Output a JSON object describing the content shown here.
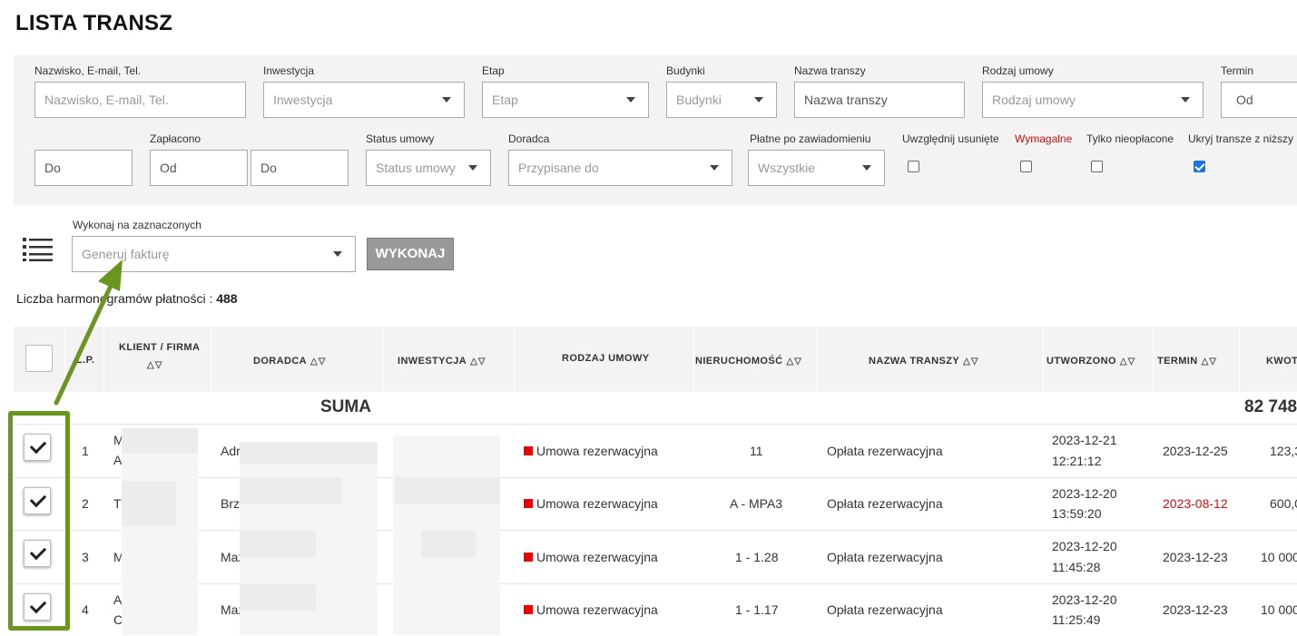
{
  "page": {
    "title": "LISTA TRANSZ"
  },
  "filters": {
    "row1": [
      {
        "label": "Nazwisko, E-mail, Tel.",
        "placeholder": "Nazwisko, E-mail, Tel."
      },
      {
        "label": "Inwestycja",
        "placeholder": "Inwestycja"
      },
      {
        "label": "Etap",
        "placeholder": "Etap"
      },
      {
        "label": "Budynki",
        "placeholder": "Budynki"
      },
      {
        "label": "Nazwa transzy",
        "placeholder": "Nazwa transzy"
      },
      {
        "label": "Rodzaj umowy",
        "placeholder": "Rodzaj umowy"
      },
      {
        "label": "Termin",
        "placeholder": "Od"
      }
    ],
    "termin_do": "Do",
    "zaplacono": {
      "label": "Zapłacono",
      "from": "Od",
      "to": "Do"
    },
    "status": {
      "label": "Status umowy",
      "placeholder": "Status umowy"
    },
    "doradca": {
      "label": "Doradca",
      "placeholder": "Przypisane do"
    },
    "platne": {
      "label": "Płatne po zawiadomieniu",
      "value": "Wszystkie"
    },
    "checkboxes": [
      {
        "label": "Uwzględnij usunięte",
        "checked": false
      },
      {
        "label": "Wymagalne",
        "checked": false,
        "color": "#d01010"
      },
      {
        "label": "Tylko nieopłacone",
        "checked": false
      },
      {
        "label": "Ukryj transze z niższy",
        "checked": true
      }
    ]
  },
  "bulk": {
    "label": "Wykonaj na zaznaczonych",
    "value": "Generuj fakturę",
    "button": "WYKONAJ",
    "icon": "list-icon"
  },
  "count": {
    "label": "Liczba harmonogramów płatności :",
    "value": "488"
  },
  "table": {
    "headers": {
      "lp": "L.P.",
      "klient": "KLIENT / FIRMA",
      "doradca": "DORADCA",
      "inwestycja": "INWESTYCJA",
      "rodzaj": "RODZAJ UMOWY",
      "nieruchomosc": "NIERUCHOMOŚĆ",
      "nazwa": "NAZWA TRANSZY",
      "utworzono": "UTWORZONO",
      "termin": "TERMIN",
      "kwota": "KWOT"
    },
    "sort_glyph": "△▽",
    "sum_label": "SUMA",
    "sum_value": "82 748",
    "rows": [
      {
        "lp": "1",
        "klient1": "M",
        "klient2": "A",
        "doradca": "Adr",
        "rodzaj": "Umowa rezerwacyjna",
        "nieruchomosc": "11",
        "nazwa": "Opłata rezerwacyjna",
        "utw_date": "2023-12-21",
        "utw_time": "12:21:12",
        "termin": "2023-12-25",
        "termin_overdue": false,
        "kwota": "123,3"
      },
      {
        "lp": "2",
        "klient1": "T",
        "klient2": "",
        "doradca": "Brz",
        "rodzaj": "Umowa rezerwacyjna",
        "nieruchomosc": "A - MPA3",
        "nazwa": "Opłata rezerwacyjna",
        "utw_date": "2023-12-20",
        "utw_time": "13:59:20",
        "termin": "2023-08-12",
        "termin_overdue": true,
        "kwota": "600,0"
      },
      {
        "lp": "3",
        "klient1": "M",
        "klient2": "",
        "doradca": "Maz",
        "rodzaj": "Umowa rezerwacyjna",
        "nieruchomosc": "1 - 1.28",
        "nazwa": "Opłata rezerwacyjna",
        "utw_date": "2023-12-20",
        "utw_time": "11:45:28",
        "termin": "2023-12-23",
        "termin_overdue": false,
        "kwota": "10 000"
      },
      {
        "lp": "4",
        "klient1": "A",
        "klient2": "C",
        "doradca": "Maz",
        "rodzaj": "Umowa rezerwacyjna",
        "nieruchomosc": "1 - 1.17",
        "nazwa": "Opłata rezerwacyjna",
        "utw_date": "2023-12-20",
        "utw_time": "11:25:49",
        "termin": "2023-12-23",
        "termin_overdue": false,
        "kwota": "10 000"
      }
    ]
  },
  "colors": {
    "accent_green": "#6b9521",
    "overdue": "#d01010",
    "status_square": "#ee0000"
  }
}
